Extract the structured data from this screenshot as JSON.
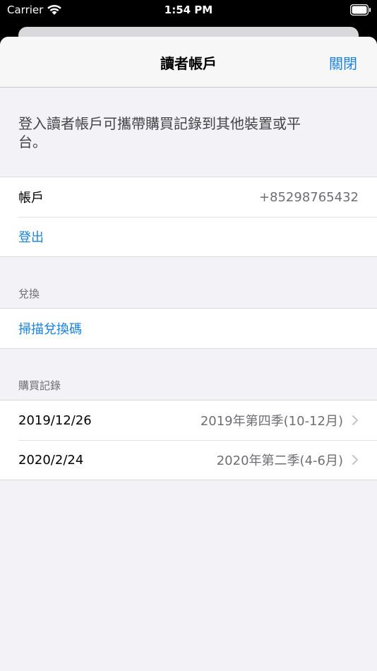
{
  "status_bar": {
    "carrier": "Carrier",
    "time": "1:54 PM"
  },
  "nav": {
    "title": "讀者帳戶",
    "close_label": "關閉"
  },
  "description": "登入讀者帳戶可攜帶購買記錄到其他裝置或平台。",
  "account": {
    "label": "帳戶",
    "value": "+85298765432",
    "logout_label": "登出"
  },
  "redeem": {
    "header": "兌換",
    "scan_label": "掃描兌換碼"
  },
  "purchases": {
    "header": "購買記錄",
    "items": [
      {
        "date": "2019/12/26",
        "title": "2019年第四季(10-12月)"
      },
      {
        "date": "2020/2/24",
        "title": "2020年第二季(4-6月)"
      }
    ]
  },
  "colors": {
    "accent": "#1a82e2",
    "background": "#f2f2f7"
  }
}
